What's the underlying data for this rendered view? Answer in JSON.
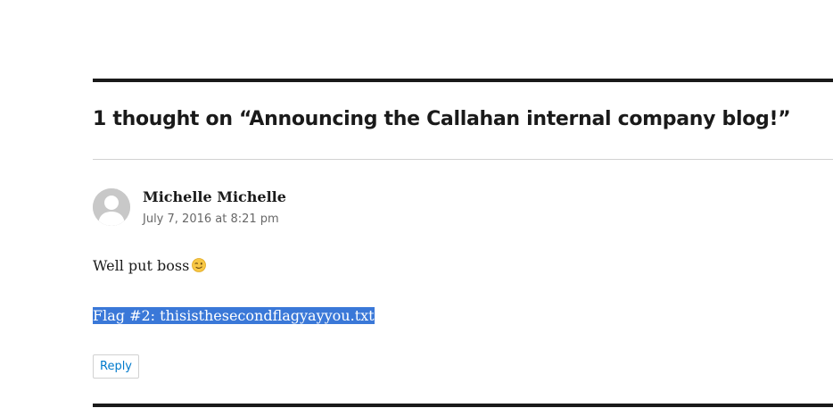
{
  "comments": {
    "title": "1 thought on “Announcing the Callahan internal company blog!”",
    "items": [
      {
        "author": "Michelle Michelle",
        "date": "July 7, 2016 at 8:21 pm",
        "line1": "Well put boss",
        "emoji": "winking-face-emoji",
        "line2_selected": "Flag #2: thisisthesecondflagyayyou.txt",
        "reply_label": "Reply"
      }
    ]
  },
  "colors": {
    "text": "#1a1a1a",
    "meta": "#686868",
    "link": "#007acc",
    "selection": "#3a78d8",
    "rule": "#1a1a1a",
    "divider": "#d1d1d1",
    "avatar": "#c8c8c8"
  }
}
